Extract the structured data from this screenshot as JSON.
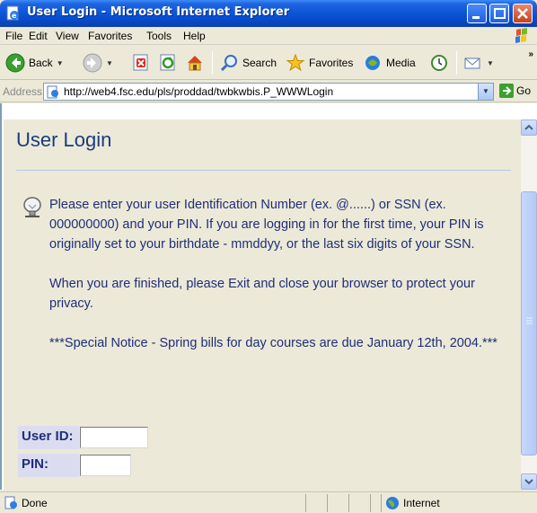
{
  "window": {
    "title": "User Login - Microsoft Internet Explorer"
  },
  "menu": {
    "items": [
      "File",
      "Edit",
      "View",
      "Favorites",
      "Tools",
      "Help"
    ]
  },
  "toolbar": {
    "back_label": "Back",
    "search_label": "Search",
    "favorites_label": "Favorites",
    "media_label": "Media"
  },
  "address": {
    "label": "Address",
    "url": "http://web4.fsc.edu/pls/proddad/twbkwbis.P_WWWLogin",
    "go_label": "Go"
  },
  "page": {
    "title": "User Login",
    "info_paragraphs": [
      "Please enter your user Identification Number (ex. @......) or SSN (ex. 000000000) and your PIN. If you are logging in for the first time, your PIN is originally set to your birthdate - mmddyy, or the last six digits of your SSN.",
      "When you are finished, please Exit and close your browser to protect your privacy.",
      "***Special Notice - Spring bills for day courses are due January 12th, 2004.***"
    ],
    "form": {
      "user_id_label": "User ID:",
      "user_id_value": "",
      "pin_label": "PIN:",
      "pin_value": ""
    }
  },
  "status": {
    "text": "Done",
    "zone": "Internet"
  },
  "colors": {
    "title_bar": "#0a55d8",
    "page_text": "#1f2e7a",
    "label_bg": "#dcdcf0"
  }
}
